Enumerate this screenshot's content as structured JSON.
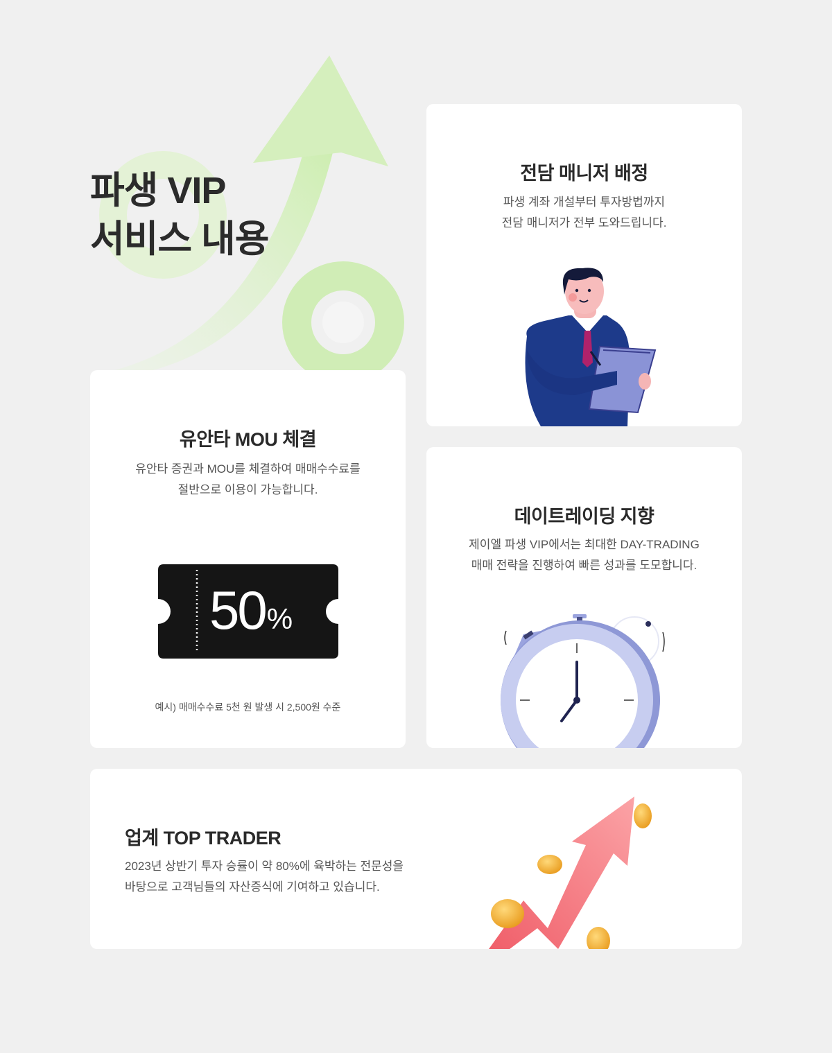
{
  "hero": {
    "title_line1": "파생 VIP",
    "title_line2": "서비스 내용"
  },
  "cards": {
    "manager": {
      "title": "전담 매니저 배정",
      "desc_line1": "파생 계좌 개설부터 투자방법까지",
      "desc_line2": "전담 매니저가 전부 도와드립니다."
    },
    "mou": {
      "title": "유안타 MOU 체결",
      "desc_line1": "유안타 증권과 MOU를 체결하여 매매수수료를",
      "desc_line2": "절반으로 이용이 가능합니다.",
      "coupon_value": "50",
      "coupon_unit": "%",
      "note": "예시) 매매수수료 5천 원 발생 시 2,500원 수준"
    },
    "daytrading": {
      "title": "데이트레이딩 지향",
      "desc_line1": "제이엘 파생 VIP에서는 최대한 DAY-TRADING",
      "desc_line2": "매매 전략을 진행하여 빠른 성과를 도모합니다."
    },
    "top_trader": {
      "title": "업계 TOP TRADER",
      "desc_line1": "2023년 상반기 투자 승률이 약 80%에 육박하는 전문성을",
      "desc_line2": "바탕으로 고객님들의 자산증식에 기여하고 있습니다."
    }
  },
  "colors": {
    "background": "#f0f0f0",
    "card": "#ffffff",
    "deco_green": "#d3efb9",
    "suit_navy": "#1d3a8a",
    "clipboard": "#8a93d6",
    "clock_lavender": "#c7cdf0",
    "arrow_pink": "#f27a82",
    "coin_gold": "#f5b730",
    "coupon_black": "#151515"
  },
  "icons": [
    "green-arrow-percent-decoration",
    "manager-with-clipboard-illustration",
    "stopwatch-icon",
    "rising-arrow-coins-illustration"
  ]
}
